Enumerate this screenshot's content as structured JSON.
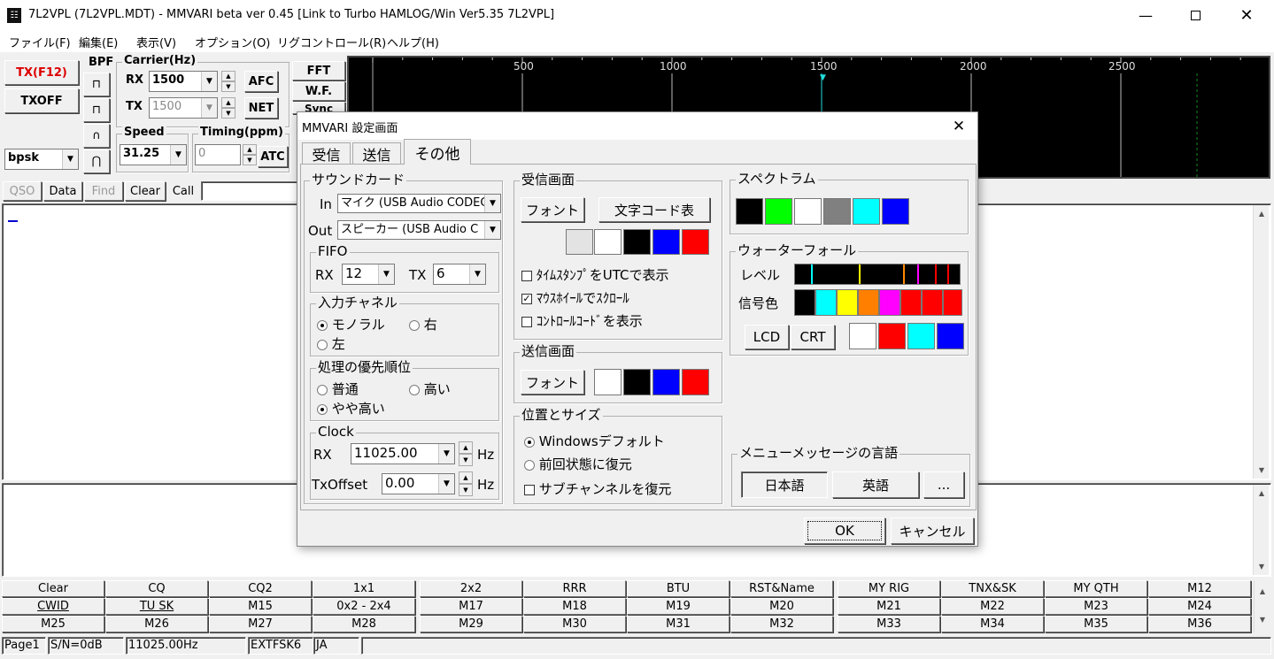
{
  "window": {
    "title": "7L2VPL (7L2VPL.MDT) - MMVARI beta ver 0.45 [Link to Turbo HAMLOG/Win Ver5.35 7L2VPL]"
  },
  "menu": [
    "ファイル(F)",
    "編集(E)",
    "表示(V)",
    "オプション(O)",
    "リグコントロール(R)",
    "ヘルプ(H)"
  ],
  "controls": {
    "tx": "TX(F12)",
    "txoff": "TXOFF",
    "mode": "bpsk",
    "bpf": "BPF",
    "carrier": "Carrier(Hz)",
    "rx_label": "RX",
    "rx_val": "1500",
    "tx_label": "TX",
    "tx_val": "1500",
    "afc": "AFC",
    "net": "NET",
    "speed": "Speed",
    "speed_val": "31.25",
    "timing": "Timing(ppm)",
    "timing_val": "0",
    "atc": "ATC",
    "fft": "FFT",
    "wf": "W.F.",
    "sync": "Sync"
  },
  "toolbar": [
    "QSO",
    "Data",
    "Find",
    "Clear",
    "Call"
  ],
  "spectrum": {
    "ticks": [
      "500",
      "1000",
      "1500",
      "2000",
      "2500"
    ]
  },
  "macros": {
    "row1": [
      "Clear",
      "CQ",
      "CQ2",
      "1x1",
      "2x2",
      "RRR",
      "BTU",
      "RST&Name",
      "MY RIG",
      "TNX&SK",
      "MY QTH",
      "M12"
    ],
    "row2": [
      "CWID",
      "TU SK",
      "M15",
      "0x2 - 2x4",
      "M17",
      "M18",
      "M19",
      "M20",
      "M21",
      "M22",
      "M23",
      "M24"
    ],
    "row3": [
      "M25",
      "M26",
      "M27",
      "M28",
      "M29",
      "M30",
      "M31",
      "M32",
      "M33",
      "M34",
      "M35",
      "M36"
    ]
  },
  "status": {
    "page": "Page1",
    "sn": "S/N=0dB",
    "freq": "11025.00Hz",
    "ext": "EXTFSK6",
    "lang": "JA"
  },
  "dialog": {
    "title": "MMVARI 設定画面",
    "tabs": [
      "受信",
      "送信",
      "その他"
    ],
    "sound": {
      "label": "サウンドカード",
      "in_label": "In",
      "in_val": "マイク (USB Audio CODEC",
      "out_label": "Out",
      "out_val": "スピーカー (USB Audio C"
    },
    "fifo": {
      "label": "FIFO",
      "rx_label": "RX",
      "rx_val": "12",
      "tx_label": "TX",
      "tx_val": "6"
    },
    "channel": {
      "label": "入力チャネル",
      "mono": "モノラル",
      "right": "右",
      "left": "左"
    },
    "priority": {
      "label": "処理の優先順位",
      "normal": "普通",
      "high": "高い",
      "slightly": "やや高い"
    },
    "clock": {
      "label": "Clock",
      "rx_label": "RX",
      "rx_val": "11025.00",
      "rx_unit": "Hz",
      "tx_label": "TxOffset",
      "tx_val": "0.00",
      "tx_unit": "Hz"
    },
    "rxscreen": {
      "label": "受信画面",
      "font": "フォント",
      "charcode": "文字コード表",
      "utc": "ﾀｲﾑｽﾀﾝﾌﾟをUTCで表示",
      "wheel": "ﾏｳｽﾎｲｰﾙでｽｸﾛｰﾙ",
      "ctrl": "ｺﾝﾄﾛｰﾙｺｰﾄﾞを表示"
    },
    "txscreen": {
      "label": "送信画面",
      "font": "フォント"
    },
    "pos": {
      "label": "位置とサイズ",
      "windows": "Windowsデフォルト",
      "restore": "前回状態に復元",
      "subch": "サブチャンネルを復元"
    },
    "spec": {
      "label": "スペクトラム"
    },
    "wf": {
      "label": "ウォーターフォール",
      "level": "レベル",
      "sigcolor": "信号色",
      "lcd": "LCD",
      "crt": "CRT"
    },
    "lang": {
      "label": "メニューメッセージの言語",
      "jp": "日本語",
      "en": "英語",
      "more": "..."
    },
    "ok": "OK",
    "cancel": "キャンセル"
  }
}
